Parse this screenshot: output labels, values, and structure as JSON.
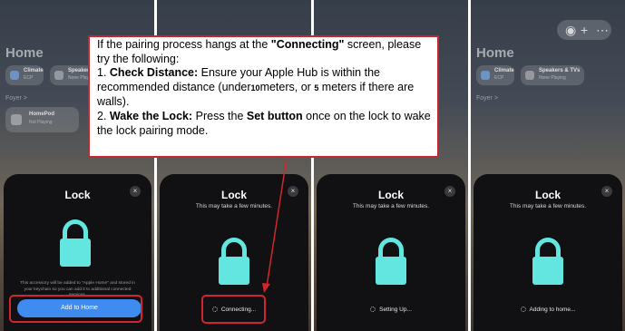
{
  "home": {
    "title": "Home",
    "foyer_label": "Foyer >",
    "climate_title": "Climate",
    "climate_sub": "ECP",
    "speakers_title": "Speakers",
    "speakers_sub": "None Playing",
    "speakers_title_alt": "Speakers & TVs",
    "speakers_sub_alt": "None Playing",
    "homepod_title": "HomePod",
    "homepod_sub": "Not Playing"
  },
  "sheets": [
    {
      "title": "Lock",
      "subtitle": "",
      "consent": "This accessory will be added to \"Apple Home\" and stored in your keychain so you can add it to additional connected services.",
      "button_label": "Add to Home"
    },
    {
      "title": "Lock",
      "subtitle": "This may take a few minutes.",
      "status": "Connecting..."
    },
    {
      "title": "Lock",
      "subtitle": "This may take a few minutes.",
      "status": "Setting Up..."
    },
    {
      "title": "Lock",
      "subtitle": "This may take a few minutes.",
      "status": "Adding to home..."
    }
  ],
  "icons": {
    "close": "×",
    "lock": "lock-icon",
    "spinner": "spinner-icon"
  },
  "callout": {
    "intro_pre": "If the pairing process hangs at the ",
    "intro_bold": "\"Connecting\"",
    "intro_post": " screen, please try the following:",
    "step1_num": "1.  ",
    "step1_bold": "Check Distance:",
    "step1_a": " Ensure your Apple Hub is within the recommended distance (under",
    "step1_n1": "10",
    "step1_b": "meters, or ",
    "step1_n2": "5",
    "step1_c": " meters if there are walls).",
    "step2_num": "2.  ",
    "step2_bold": "Wake the Lock:",
    "step2_a": " Press the ",
    "step2_bold2": "Set button",
    "step2_b": " once on the lock to wake the lock pairing mode."
  },
  "colors": {
    "accent_blue": "#3f8cf0",
    "lock_teal": "#64e6e0",
    "annotation_red": "#d0262d"
  }
}
